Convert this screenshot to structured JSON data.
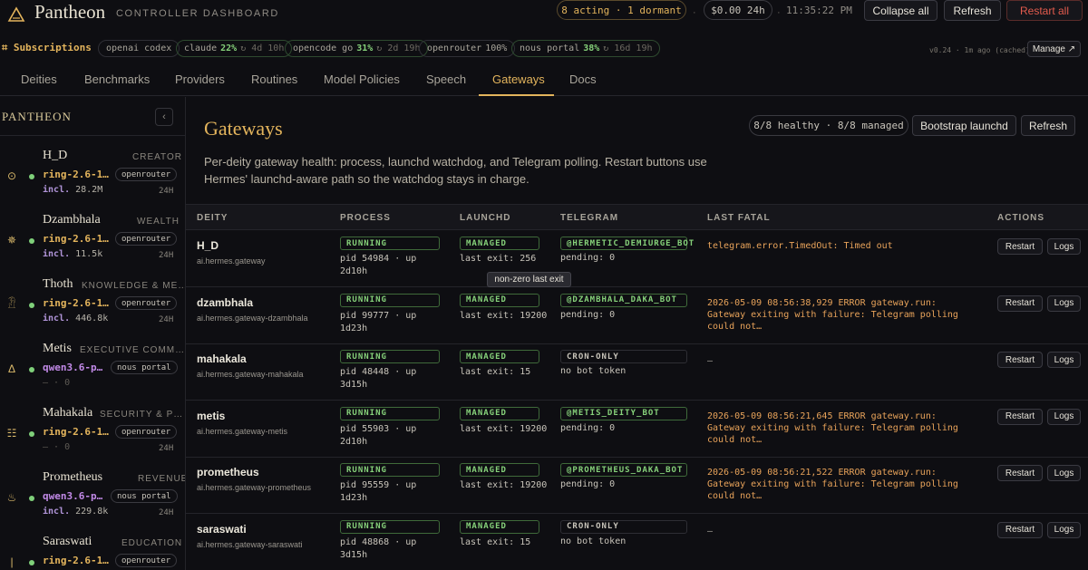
{
  "app": {
    "brand": "Pantheon",
    "subtitle": "CONTROLLER DASHBOARD"
  },
  "topbar": {
    "status": "8 acting · 1 dormant",
    "sep": "·",
    "cost": "$0.00 24h",
    "clock": "11:35:22 PM",
    "collapse_label": "Collapse all",
    "refresh_label": "Refresh",
    "restart_all_label": "Restart all"
  },
  "subscriptions": {
    "title": "⌗ Subscriptions",
    "chips": [
      {
        "name": "openai codex",
        "pct": "",
        "meta": ""
      },
      {
        "name": "claude",
        "pct": "22%",
        "meta": "↻ 4d 10h"
      },
      {
        "name": "opencode go",
        "pct": "31%",
        "meta": "↻ 2d 19h"
      },
      {
        "name": "openrouter",
        "pct": "100%",
        "meta": ""
      },
      {
        "name": "nous portal",
        "pct": "38%",
        "meta": "↻ 16d 19h"
      }
    ],
    "version": "v0.24 · 1m ago (cached)",
    "manage_label": "Manage ↗"
  },
  "tabs": [
    "Deities",
    "Benchmarks",
    "Providers",
    "Routines",
    "Model Policies",
    "Speech",
    "Gateways",
    "Docs"
  ],
  "active_tab": "Gateways",
  "sidebar": {
    "title": "PANTHEON",
    "collapse_icon": "‹",
    "deities": [
      {
        "name": "H_D",
        "role": "CREATOR",
        "icon": "⊙",
        "model": "ring-2.6-1…",
        "provider": "openrouter",
        "incl_label": "incl.",
        "incl": "28.2M",
        "period": "24H"
      },
      {
        "name": "Dzambhala",
        "role": "WEALTH",
        "icon": "✵",
        "model": "ring-2.6-1…",
        "provider": "openrouter",
        "incl_label": "incl.",
        "incl": "11.5k",
        "period": "24H"
      },
      {
        "name": "Thoth",
        "role": "KNOWLEDGE & ME…",
        "icon": "𓁟",
        "model": "ring-2.6-1…",
        "provider": "openrouter",
        "incl_label": "incl.",
        "incl": "446.8k",
        "period": "24H"
      },
      {
        "name": "Metis",
        "role": "EXECUTIVE COMM…",
        "icon": "Δ",
        "model": "qwen3.6-p…",
        "provider": "nous portal",
        "incl_label": "",
        "incl": "— · 0",
        "period": ""
      },
      {
        "name": "Mahakala",
        "role": "SECURITY & P…",
        "icon": "☷",
        "model": "ring-2.6-1…",
        "provider": "openrouter",
        "incl_label": "",
        "incl": "— · 0",
        "period": "24H"
      },
      {
        "name": "Prometheus",
        "role": "REVENUE & …",
        "icon": "♨",
        "model": "qwen3.6-p…",
        "provider": "nous portal",
        "incl_label": "incl.",
        "incl": "229.8k",
        "period": "24H"
      },
      {
        "name": "Saraswati",
        "role": "EDUCATION",
        "icon": "|",
        "model": "ring-2.6-1…",
        "provider": "openrouter",
        "incl_label": "",
        "incl": "",
        "period": ""
      }
    ]
  },
  "main": {
    "title": "Gateways",
    "healthy": "8/8 healthy · 8/8 managed",
    "bootstrap_label": "Bootstrap launchd",
    "refresh_label": "Refresh",
    "description": "Per-deity gateway health: process, launchd watchdog, and Telegram polling. Restart buttons use Hermes' launchd-aware path so the watchdog stays in charge.",
    "columns": [
      "DEITY",
      "PROCESS",
      "LAUNCHD",
      "TELEGRAM",
      "LAST FATAL",
      "ACTIONS"
    ],
    "restart_label": "Restart",
    "logs_label": "Logs",
    "tooltip": "non-zero last exit",
    "rows": [
      {
        "name": "H_D",
        "label": "ai.hermes.gateway",
        "process": "RUNNING",
        "proc_detail": "pid 54984 · up 2d10h",
        "launchd": "MANAGED",
        "last_exit": "last exit: 256",
        "telegram": "@HERMETIC_DEMIURGE_BOT",
        "tele_kind": "bot",
        "tele_detail": "pending: 0",
        "fatal": "telegram.error.TimedOut: Timed out"
      },
      {
        "name": "dzambhala",
        "label": "ai.hermes.gateway-dzambhala",
        "process": "RUNNING",
        "proc_detail": "pid 99777 · up 1d23h",
        "launchd": "MANAGED",
        "last_exit": "last exit: 19200",
        "telegram": "@DZAMBHALA_DAKA_BOT",
        "tele_kind": "bot",
        "tele_detail": "pending: 0",
        "fatal": "2026-05-09 08:56:38,929 ERROR gateway.run: Gateway exiting with failure: Telegram polling could not…"
      },
      {
        "name": "mahakala",
        "label": "ai.hermes.gateway-mahakala",
        "process": "RUNNING",
        "proc_detail": "pid 48448 · up 3d15h",
        "launchd": "MANAGED",
        "last_exit": "last exit: 15",
        "telegram": "CRON-ONLY",
        "tele_kind": "cron",
        "tele_detail": "no bot token",
        "fatal": "—"
      },
      {
        "name": "metis",
        "label": "ai.hermes.gateway-metis",
        "process": "RUNNING",
        "proc_detail": "pid 55903 · up 2d10h",
        "launchd": "MANAGED",
        "last_exit": "last exit: 19200",
        "telegram": "@METIS_DEITY_BOT",
        "tele_kind": "bot",
        "tele_detail": "pending: 0",
        "fatal": "2026-05-09 08:56:21,645 ERROR gateway.run: Gateway exiting with failure: Telegram polling could not…"
      },
      {
        "name": "prometheus",
        "label": "ai.hermes.gateway-prometheus",
        "process": "RUNNING",
        "proc_detail": "pid 95559 · up 1d23h",
        "launchd": "MANAGED",
        "last_exit": "last exit: 19200",
        "telegram": "@PROMETHEUS_DAKA_BOT",
        "tele_kind": "bot",
        "tele_detail": "pending: 0",
        "fatal": "2026-05-09 08:56:21,522 ERROR gateway.run: Gateway exiting with failure: Telegram polling could not…"
      },
      {
        "name": "saraswati",
        "label": "ai.hermes.gateway-saraswati",
        "process": "RUNNING",
        "proc_detail": "pid 48868 · up 3d15h",
        "launchd": "MANAGED",
        "last_exit": "last exit: 15",
        "telegram": "CRON-ONLY",
        "tele_kind": "cron",
        "tele_detail": "no bot token",
        "fatal": "—"
      }
    ]
  }
}
